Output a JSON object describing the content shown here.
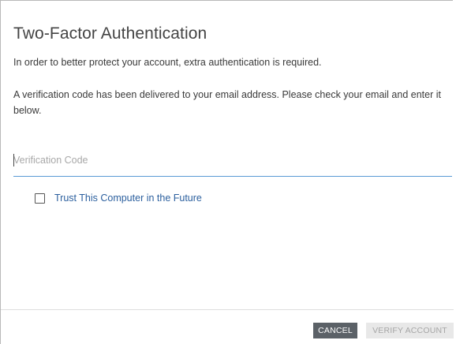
{
  "dialog": {
    "title": "Two-Factor Authentication",
    "intro_text": "In order to better protect your account, extra authentication is required.",
    "instruction_text": "A verification code has been delivered to your email address. Please check your email and enter it below.",
    "code_input": {
      "placeholder": "Verification Code",
      "value": ""
    },
    "trust_checkbox": {
      "label": "Trust This Computer in the Future",
      "checked": false
    },
    "buttons": {
      "cancel_label": "CANCEL",
      "verify_label": "VERIFY ACCOUNT"
    },
    "colors": {
      "link_text": "#2b5f9e",
      "input_underline": "#5a9bd5",
      "cancel_bg": "#5b6167",
      "verify_bg_disabled": "#e8e8e8"
    }
  }
}
